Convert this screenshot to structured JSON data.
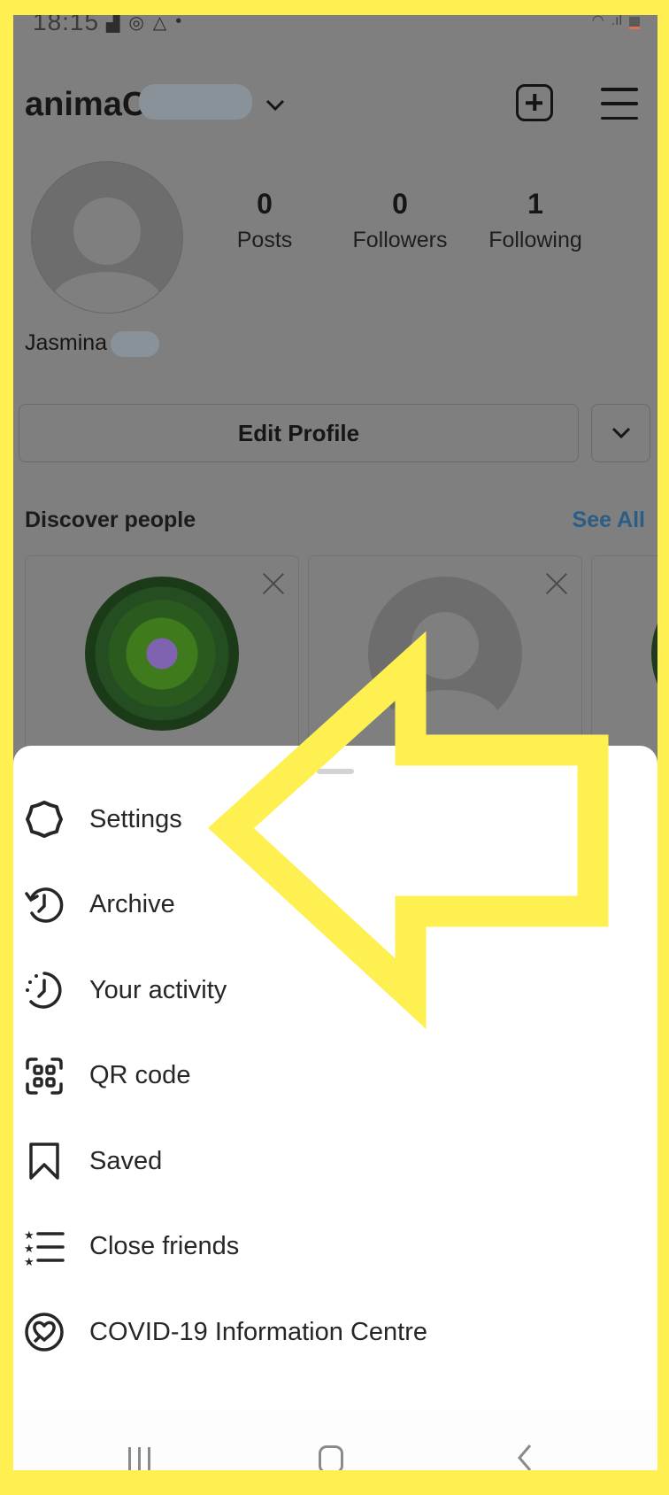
{
  "status_bar": {
    "time": "18:15",
    "notification_icons": [
      "image-icon",
      "sync-icon",
      "drive-icon",
      "dot-icon"
    ],
    "system_icons": [
      "wifi-icon",
      "signal-icon",
      "battery-icon"
    ]
  },
  "header": {
    "username": "animaC",
    "username_redacted": true,
    "add_icon": "plus-square-icon",
    "menu_icon": "hamburger-menu-icon"
  },
  "profile": {
    "full_name": "Jasmina",
    "full_name_redacted": true,
    "stats": [
      {
        "value": "0",
        "label": "Posts"
      },
      {
        "value": "0",
        "label": "Followers"
      },
      {
        "value": "1",
        "label": "Following"
      }
    ],
    "edit_profile_label": "Edit Profile"
  },
  "discover": {
    "title": "Discover people",
    "see_all_label": "See All",
    "see_all_color": "#2a5d88",
    "cards": [
      {
        "avatar": "green-mandala-photo"
      },
      {
        "avatar": "default-avatar"
      },
      {
        "avatar": "partial-photo"
      }
    ]
  },
  "sheet": {
    "items": [
      {
        "label": "Settings",
        "icon": "settings-icon"
      },
      {
        "label": "Archive",
        "icon": "archive-icon"
      },
      {
        "label": "Your activity",
        "icon": "activity-icon"
      },
      {
        "label": "QR code",
        "icon": "qr-code-icon"
      },
      {
        "label": "Saved",
        "icon": "bookmark-icon"
      },
      {
        "label": "Close friends",
        "icon": "close-friends-icon"
      },
      {
        "label": "COVID-19 Information Centre",
        "icon": "covid-heart-icon"
      }
    ]
  },
  "annotation": {
    "type": "arrow",
    "points_to": "Settings",
    "color": "#fdf050"
  },
  "nav_bar": {
    "buttons": [
      "recent-apps",
      "home",
      "back"
    ]
  }
}
